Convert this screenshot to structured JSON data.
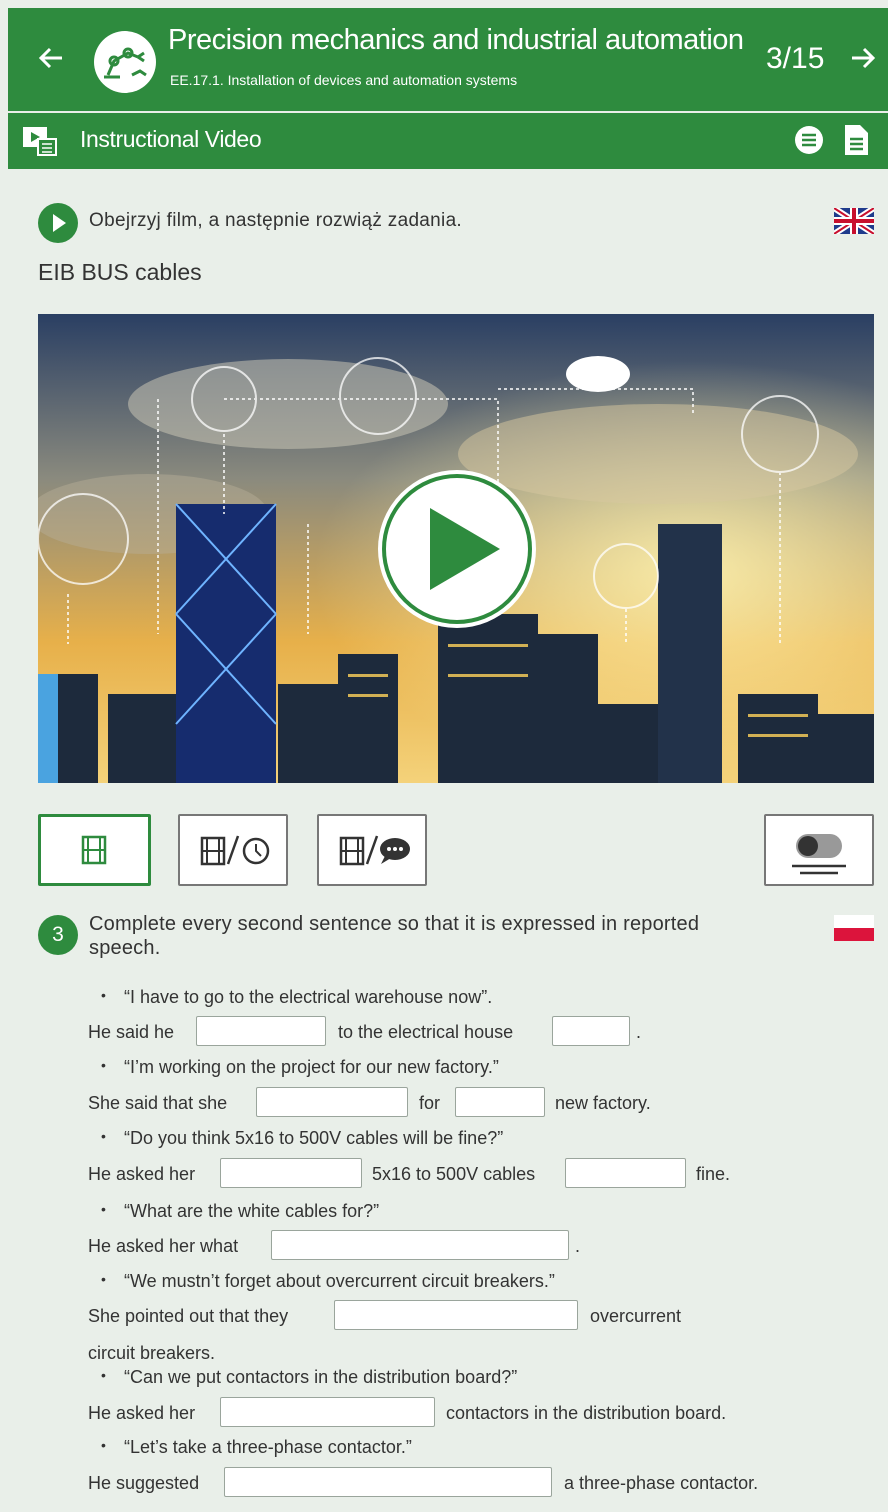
{
  "header": {
    "title": "Precision mechanics and industrial automation",
    "subtitle": "EE.17.1. Installation of devices and automation systems",
    "page": "3/15",
    "back_icon": "arrow-left-icon",
    "next_icon": "arrow-right-icon",
    "logo_icon": "robot-arm-logo"
  },
  "section": {
    "label": "Instructional Video",
    "icon": "video-icon",
    "menu_icon": "list-circle-icon",
    "doc_icon": "document-icon"
  },
  "instruction": {
    "text": "Obejrzyj film, a następnie rozwiąż zadania.",
    "language_flag": "uk-flag-icon"
  },
  "video": {
    "title": "EIB BUS cables",
    "play_icon": "play-icon"
  },
  "mode_buttons": [
    {
      "name": "film-icon",
      "active": true
    },
    {
      "name": "film-clock-icon",
      "active": false
    },
    {
      "name": "film-chat-icon",
      "active": false
    },
    {
      "name": "subtitles-toggle-icon",
      "active": false
    }
  ],
  "task": {
    "number": "3",
    "text": "Complete every second sentence so that it is expressed in reported speech.",
    "language_flag": "pl-flag-icon"
  },
  "exercises": {
    "q1": "“I have to go to the electrical warehouse now”.",
    "a1_pre": "He said he",
    "a1_mid": "to the electrical house",
    "a1_end": ".",
    "q2": "“I’m working on the project for our new factory.”",
    "a2_pre": "She said that she",
    "a2_mid": "for",
    "a2_end": "new factory.",
    "q3": "“Do you think 5x16 to 500V cables will be fine?”",
    "a3_pre": "He asked her",
    "a3_mid": "5x16 to 500V cables",
    "a3_end": "fine.",
    "q4": "“What are the white cables for?”",
    "a4_pre": "He asked her what",
    "a4_end": ".",
    "q5": "“We mustn’t forget about overcurrent circuit breakers.”",
    "a5_pre": "She pointed out that they",
    "a5_mid": "overcurrent",
    "a5_cont": "circuit breakers.",
    "q6": "“Can we put contactors in the distribution board?”",
    "a6_pre": "He asked her",
    "a6_end": "contactors in the distribution board.",
    "q7": "“Let’s take a three-phase contactor.”",
    "a7_pre": "He suggested",
    "a7_end": "a three-phase contactor."
  },
  "colors": {
    "brand": "#2e8b3e",
    "background": "#e9efe9"
  }
}
